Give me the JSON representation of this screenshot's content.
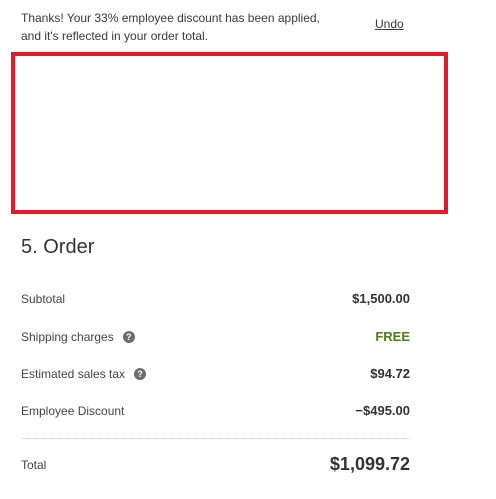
{
  "notice": {
    "text": "Thanks! Your 33% employee discount has been applied, and it's reflected in your order total.",
    "undo_label": "Undo"
  },
  "order": {
    "title": "5. Order",
    "rows": [
      {
        "label": "Subtotal",
        "value": "$1,500.00",
        "has_help": false
      },
      {
        "label": "Shipping charges",
        "value": "FREE",
        "has_help": true
      },
      {
        "label": "Estimated sales tax",
        "value": "$94.72",
        "has_help": true
      },
      {
        "label": "Employee Discount",
        "value": "−$495.00",
        "has_help": false
      }
    ],
    "help_icon_glyph": "?",
    "total_label": "Total",
    "total_value": "$1,099.72"
  },
  "colors": {
    "highlight_border": "#dc1f2a",
    "free_text": "#4a7c24"
  }
}
